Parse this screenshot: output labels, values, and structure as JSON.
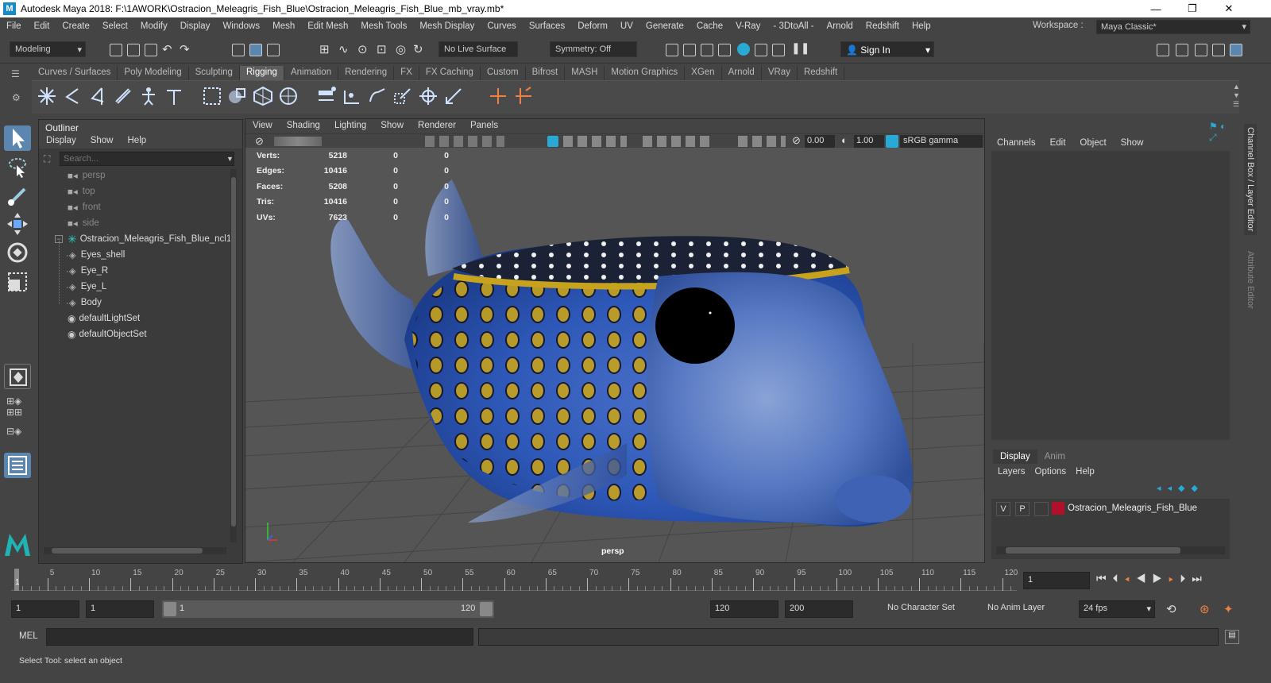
{
  "window": {
    "title": "Autodesk Maya 2018: F:\\1AWORK\\Ostracion_Meleagris_Fish_Blue\\Ostracion_Meleagris_Fish_Blue_mb_vray.mb*",
    "logo": "M",
    "min": "—",
    "max": "❐",
    "close": "✕"
  },
  "menubar": [
    "File",
    "Edit",
    "Create",
    "Select",
    "Modify",
    "Display",
    "Windows",
    "Mesh",
    "Edit Mesh",
    "Mesh Tools",
    "Mesh Display",
    "Curves",
    "Surfaces",
    "Deform",
    "UV",
    "Generate",
    "Cache",
    "V-Ray",
    "- 3DtoAll -",
    "Arnold",
    "Redshift",
    "Help"
  ],
  "workspace": {
    "label": "Workspace :",
    "value": "Maya Classic*"
  },
  "statusline": {
    "mode": "Modeling",
    "live_surface": "No Live Surface",
    "symmetry": "Symmetry: Off",
    "sign_in": "Sign In"
  },
  "shelf_tabs": [
    "Curves / Surfaces",
    "Poly Modeling",
    "Sculpting",
    "Rigging",
    "Animation",
    "Rendering",
    "FX",
    "FX Caching",
    "Custom",
    "Bifrost",
    "MASH",
    "Motion Graphics",
    "XGen",
    "Arnold",
    "VRay",
    "Redshift"
  ],
  "shelf_active": "Rigging",
  "outliner": {
    "title": "Outliner",
    "menu": [
      "Display",
      "Show",
      "Help"
    ],
    "search_placeholder": "Search...",
    "items": [
      {
        "label": "persp",
        "kind": "camera"
      },
      {
        "label": "top",
        "kind": "camera"
      },
      {
        "label": "front",
        "kind": "camera"
      },
      {
        "label": "side",
        "kind": "camera"
      },
      {
        "label": "Ostracion_Meleagris_Fish_Blue_ncl1_",
        "kind": "group"
      },
      {
        "label": "Eyes_shell",
        "kind": "mesh"
      },
      {
        "label": "Eye_R",
        "kind": "mesh"
      },
      {
        "label": "Eye_L",
        "kind": "mesh"
      },
      {
        "label": "Body",
        "kind": "mesh"
      },
      {
        "label": "defaultLightSet",
        "kind": "set"
      },
      {
        "label": "defaultObjectSet",
        "kind": "set"
      }
    ]
  },
  "viewport": {
    "menu": [
      "View",
      "Shading",
      "Lighting",
      "Show",
      "Renderer",
      "Panels"
    ],
    "exposure": "0.00",
    "gamma": "1.00",
    "colorspace": "sRGB gamma",
    "camera": "persp",
    "hud": [
      {
        "label": "Verts:",
        "a": "5218",
        "b": "0",
        "c": "0"
      },
      {
        "label": "Edges:",
        "a": "10416",
        "b": "0",
        "c": "0"
      },
      {
        "label": "Faces:",
        "a": "5208",
        "b": "0",
        "c": "0"
      },
      {
        "label": "Tris:",
        "a": "10416",
        "b": "0",
        "c": "0"
      },
      {
        "label": "UVs:",
        "a": "7623",
        "b": "0",
        "c": "0"
      }
    ]
  },
  "channelbox": {
    "menu": [
      "Channels",
      "Edit",
      "Object",
      "Show"
    ],
    "layer_tabs": [
      "Display",
      "Anim"
    ],
    "layer_menu": [
      "Layers",
      "Options",
      "Help"
    ],
    "layer": {
      "v": "V",
      "p": "P",
      "name": "Ostracion_Meleagris_Fish_Blue",
      "color": "#b0102a"
    },
    "side_labels": [
      "Channel Box / Layer Editor",
      "Attribute Editor"
    ]
  },
  "timeline": {
    "ticks": [
      "5",
      "10",
      "15",
      "20",
      "25",
      "30",
      "35",
      "40",
      "45",
      "50",
      "55",
      "60",
      "65",
      "70",
      "75",
      "80",
      "85",
      "90",
      "95",
      "100",
      "105",
      "110",
      "115",
      "120"
    ],
    "current": "1",
    "current_field": "1"
  },
  "range": {
    "start": "1",
    "inner_start": "1",
    "slider_start": "1",
    "slider_end": "120",
    "end": "120",
    "max": "200",
    "character_set": "No Character Set",
    "anim_layer": "No Anim Layer",
    "fps": "24 fps"
  },
  "cmdline": {
    "label": "MEL"
  },
  "helpline": {
    "text": "Select Tool: select an object"
  }
}
